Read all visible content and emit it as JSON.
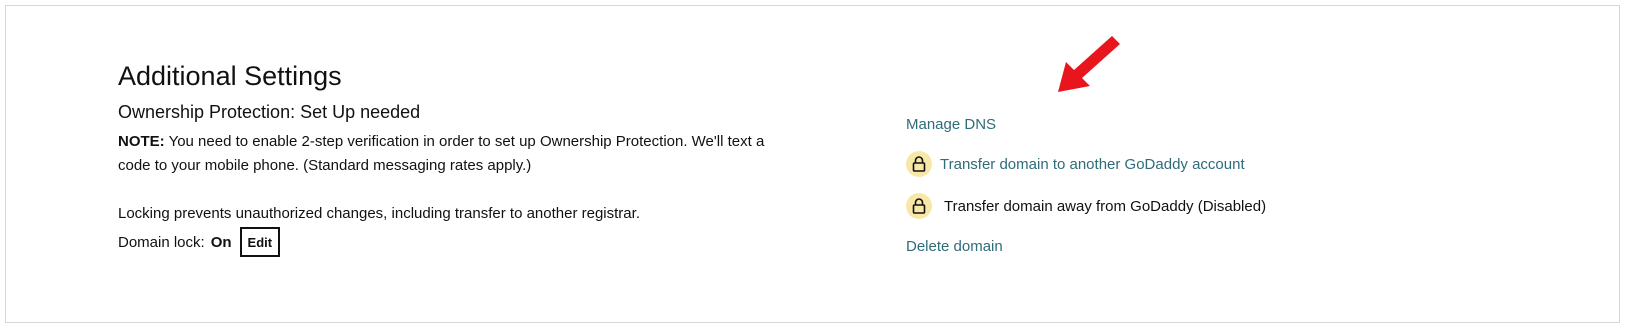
{
  "section": {
    "title": "Additional Settings",
    "subtitle": "Ownership Protection: Set Up needed",
    "note_label": "NOTE:",
    "note_text": "You need to enable 2-step verification in order to set up Ownership Protection. We'll text a code to your mobile phone. (Standard messaging rates apply.)",
    "lock_description": "Locking prevents unauthorized changes, including transfer to another registrar.",
    "domain_lock_label": "Domain lock:",
    "domain_lock_state": "On",
    "edit_label": "Edit"
  },
  "actions": {
    "manage_dns": "Manage DNS",
    "transfer_to_account": "Transfer domain to another GoDaddy account",
    "transfer_away": "Transfer domain away from GoDaddy (Disabled)",
    "delete_domain": "Delete domain"
  },
  "colors": {
    "link": "#2f6c7a",
    "lock_badge": "#f8e8a8",
    "arrow": "#e8161c"
  },
  "icons": {
    "lock": "lock-icon",
    "arrow": "red-arrow-icon"
  }
}
